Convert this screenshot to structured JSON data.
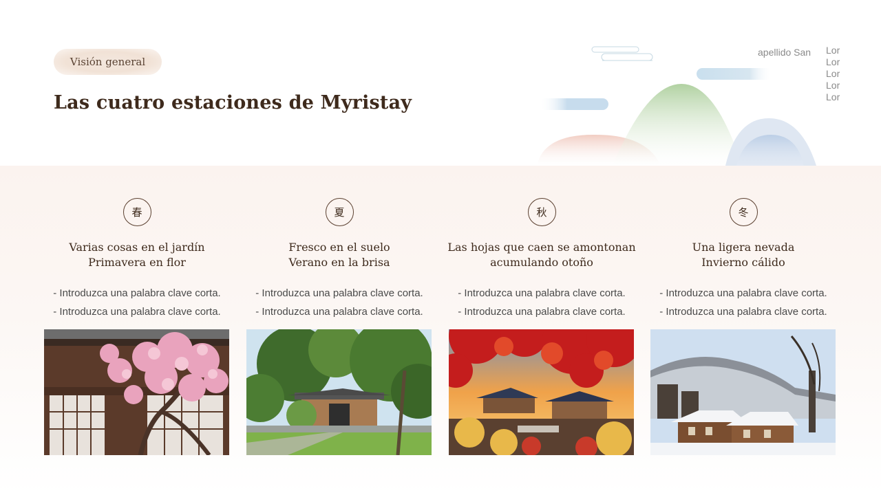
{
  "header": {
    "badge": "Visión general",
    "title": "Las cuatro estaciones de Myristay",
    "author": "apellido San",
    "side_items": [
      "Lor",
      "Lor",
      "Lor",
      "Lor",
      "Lor"
    ]
  },
  "seasons": [
    {
      "glyph": "春",
      "title_line1": "Varias cosas en el jardín",
      "title_line2": "Primavera en flor",
      "bullets": [
        "- Introduzca una palabra clave corta.",
        "- Introduzca una palabra clave corta."
      ]
    },
    {
      "glyph": "夏",
      "title_line1": "Fresco en el suelo",
      "title_line2": "Verano en la brisa",
      "bullets": [
        "- Introduzca una palabra clave corta.",
        "- Introduzca una palabra clave corta."
      ]
    },
    {
      "glyph": "秋",
      "title_line1": "Las hojas que caen se amontonan",
      "title_line2": "acumulando otoño",
      "bullets": [
        "- Introduzca una palabra clave corta.",
        "- Introduzca una palabra clave corta."
      ]
    },
    {
      "glyph": "冬",
      "title_line1": "Una ligera nevada",
      "title_line2": "Invierno cálido",
      "bullets": [
        "- Introduzca una palabra clave corta.",
        "- Introduzca una palabra clave corta."
      ]
    }
  ],
  "colors": {
    "title": "#3e2a1c",
    "accent_green": "#a9cf9a",
    "accent_blue": "#b9cde4",
    "accent_pink": "#f0c9c0"
  }
}
